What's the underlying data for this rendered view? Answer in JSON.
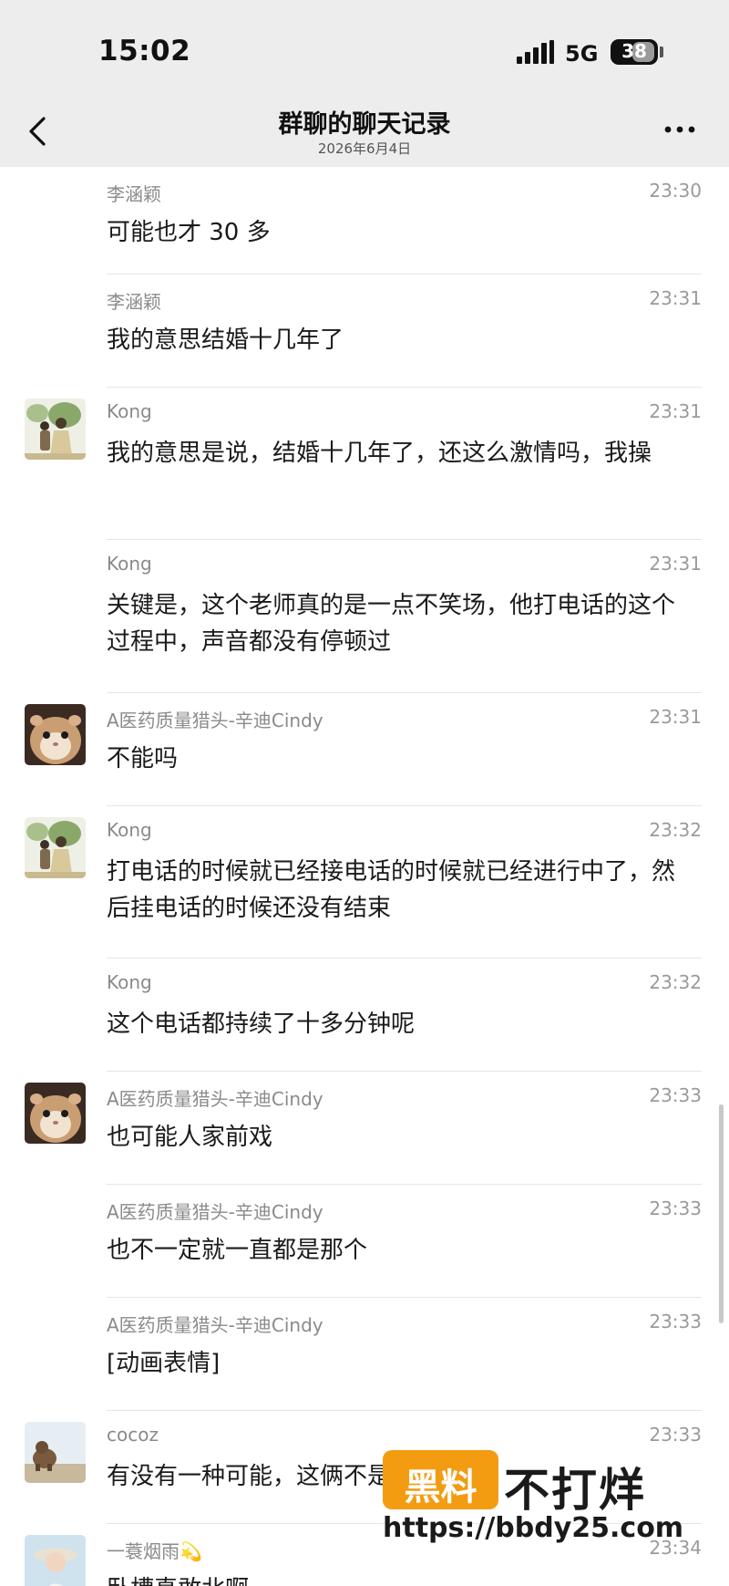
{
  "status_bar": {
    "time": "15:02",
    "network": "5G",
    "battery": "38",
    "battery_level": 0.38
  },
  "nav": {
    "title": "群聊的聊天记录",
    "date": "2026年6月4日"
  },
  "messages": [
    {
      "sender": "李涵颖",
      "time": "23:30",
      "text": "可能也才 30 多",
      "avatar": ""
    },
    {
      "sender": "李涵颖",
      "time": "23:31",
      "text": "我的意思结婚十几年了",
      "avatar": ""
    },
    {
      "sender": "Kong",
      "time": "23:31",
      "text": "我的意思是说，结婚十几年了，还这么激情吗，我操",
      "avatar": "couple-photo"
    },
    {
      "sender": "Kong",
      "time": "23:31",
      "text": "关键是，这个老师真的是一点不笑场，他打电话的这个过程中，声音都没有停顿过",
      "avatar": ""
    },
    {
      "sender": "A医药质量猎头-辛迪Cindy",
      "time": "23:31",
      "text": "不能吗",
      "avatar": "hamster-photo"
    },
    {
      "sender": "Kong",
      "time": "23:32",
      "text": "打电话的时候就已经接电话的时候就已经进行中了，然后挂电话的时候还没有结束",
      "avatar": "couple-photo"
    },
    {
      "sender": "Kong",
      "time": "23:32",
      "text": "这个电话都持续了十多分钟呢",
      "avatar": ""
    },
    {
      "sender": "A医药质量猎头-辛迪Cindy",
      "time": "23:33",
      "text": "也可能人家前戏",
      "avatar": "hamster-photo"
    },
    {
      "sender": "A医药质量猎头-辛迪Cindy",
      "time": "23:33",
      "text": "也不一定就一直都是那个",
      "avatar": ""
    },
    {
      "sender": "A医药质量猎头-辛迪Cindy",
      "time": "23:33",
      "text": "[动画表情]",
      "avatar": ""
    },
    {
      "sender": "cocoz",
      "time": "23:33",
      "text": "有没有一种可能，这俩不是夫妻",
      "avatar": "capybara-photo"
    },
    {
      "sender": "一蓑烟雨💫",
      "time": "23:34",
      "text": "卧槽真敢北啊",
      "avatar": "portrait-photo"
    }
  ],
  "watermark": {
    "box_text": "黑料",
    "brand": "不打烊",
    "url": "https://bbdy25.com"
  },
  "colors": {
    "header_bg": "#ededed",
    "watermark_orange": "#f39c12"
  }
}
